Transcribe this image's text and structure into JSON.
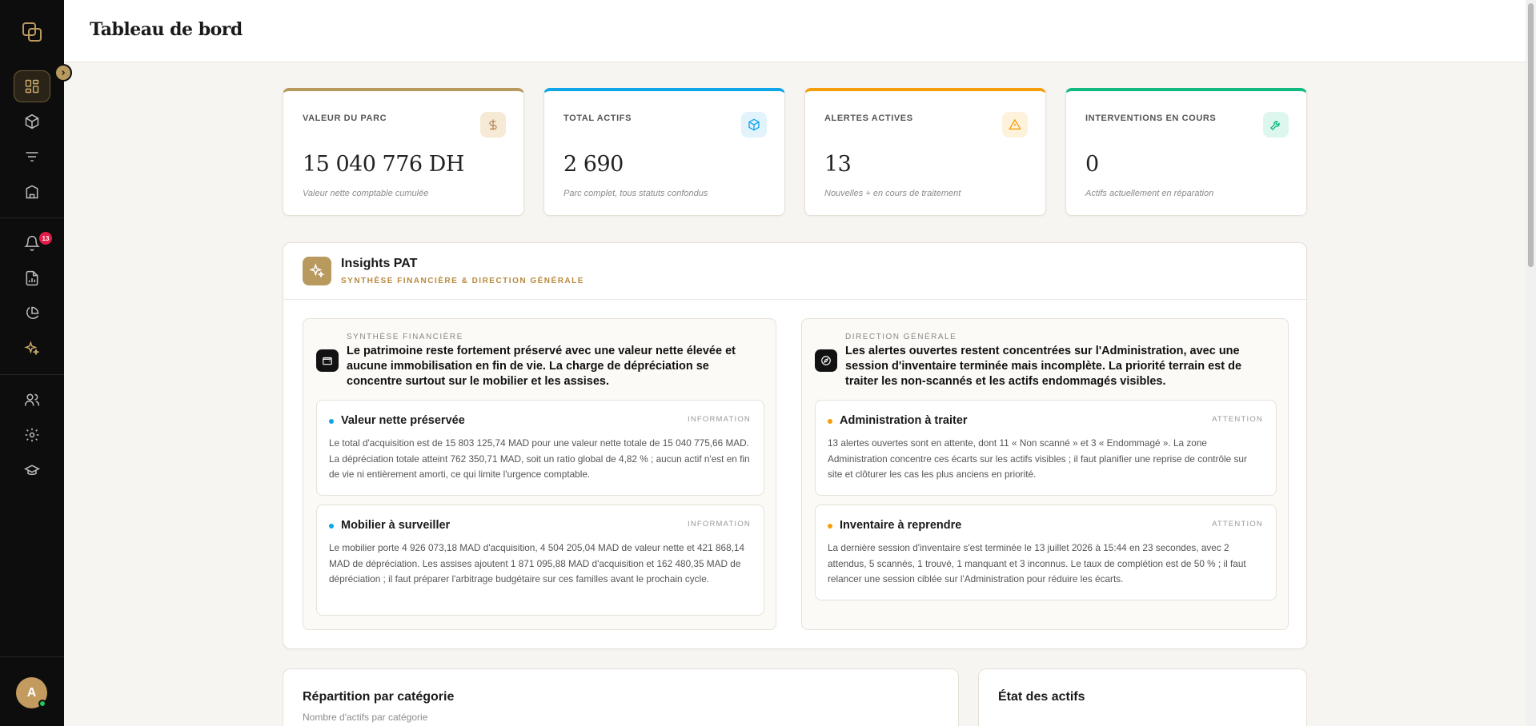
{
  "header": {
    "title": "Tableau de bord"
  },
  "sidebar": {
    "notification_badge": "13",
    "avatar_initial": "A"
  },
  "kpis": [
    {
      "label": "VALEUR DU PARC",
      "value": "15 040 776 DH",
      "desc": "Valeur nette comptable cumulée",
      "icon": "dollar-icon",
      "accent": "#b8995e"
    },
    {
      "label": "TOTAL ACTIFS",
      "value": "2 690",
      "desc": "Parc complet, tous statuts confondus",
      "icon": "box-icon",
      "accent": "#0ea5e9"
    },
    {
      "label": "ALERTES ACTIVES",
      "value": "13",
      "desc": "Nouvelles + en cours de traitement",
      "icon": "warning-icon",
      "accent": "#f59e0b"
    },
    {
      "label": "INTERVENTIONS EN COURS",
      "value": "0",
      "desc": "Actifs actuellement en réparation",
      "icon": "wrench-icon",
      "accent": "#10b981"
    }
  ],
  "insights": {
    "title": "Insights PAT",
    "subtitle": "SYNTHÈSE FINANCIÈRE & DIRECTION GÉNÉRALE",
    "panels": [
      {
        "kicker": "SYNTHÈSE FINANCIÈRE",
        "lead": "Le patrimoine reste fortement préservé avec une valeur nette élevée et aucune immobilisation en fin de vie. La charge de dépréciation se concentre surtout sur le mobilier et les assises.",
        "items": [
          {
            "title": "Valeur nette préservée",
            "tag": "INFORMATION",
            "body": "Le total d'acquisition est de 15 803 125,74 MAD pour une valeur nette totale de 15 040 775,66 MAD. La dépréciation totale atteint 762 350,71 MAD, soit un ratio global de 4,82 % ; aucun actif n'est en fin de vie ni entièrement amorti, ce qui limite l'urgence comptable."
          },
          {
            "title": "Mobilier à surveiller",
            "tag": "INFORMATION",
            "body": "Le mobilier porte 4 926 073,18 MAD d'acquisition, 4 504 205,04 MAD de valeur nette et 421 868,14 MAD de dépréciation. Les assises ajoutent 1 871 095,88 MAD d'acquisition et 162 480,35 MAD de dépréciation ; il faut préparer l'arbitrage budgétaire sur ces familles avant le prochain cycle."
          }
        ]
      },
      {
        "kicker": "DIRECTION GÉNÉRALE",
        "lead": "Les alertes ouvertes restent concentrées sur l'Administration, avec une session d'inventaire terminée mais incomplète. La priorité terrain est de traiter les non-scannés et les actifs endommagés visibles.",
        "items": [
          {
            "title": "Administration à traiter",
            "tag": "ATTENTION",
            "body": "13 alertes ouvertes sont en attente, dont 11 « Non scanné » et 3 « Endommagé ». La zone Administration concentre ces écarts sur les actifs visibles ; il faut planifier une reprise de contrôle sur site et clôturer les cas les plus anciens en priorité."
          },
          {
            "title": "Inventaire à reprendre",
            "tag": "ATTENTION",
            "body": "La dernière session d'inventaire s'est terminée le 13 juillet 2026 à 15:44 en 23 secondes, avec 2 attendus, 5 scannés, 1 trouvé, 1 manquant et 3 inconnus. Le taux de complétion est de 50 % ; il faut relancer une session ciblée sur l'Administration pour réduire les écarts."
          }
        ]
      }
    ]
  },
  "category_card": {
    "title": "Répartition par catégorie",
    "subtitle": "Nombre d'actifs par catégorie"
  },
  "status_card": {
    "title": "État des actifs"
  },
  "colors": {
    "gold": "#b8995e",
    "info_dot": "#0ea5e9",
    "attention_dot": "#f59e0b"
  }
}
